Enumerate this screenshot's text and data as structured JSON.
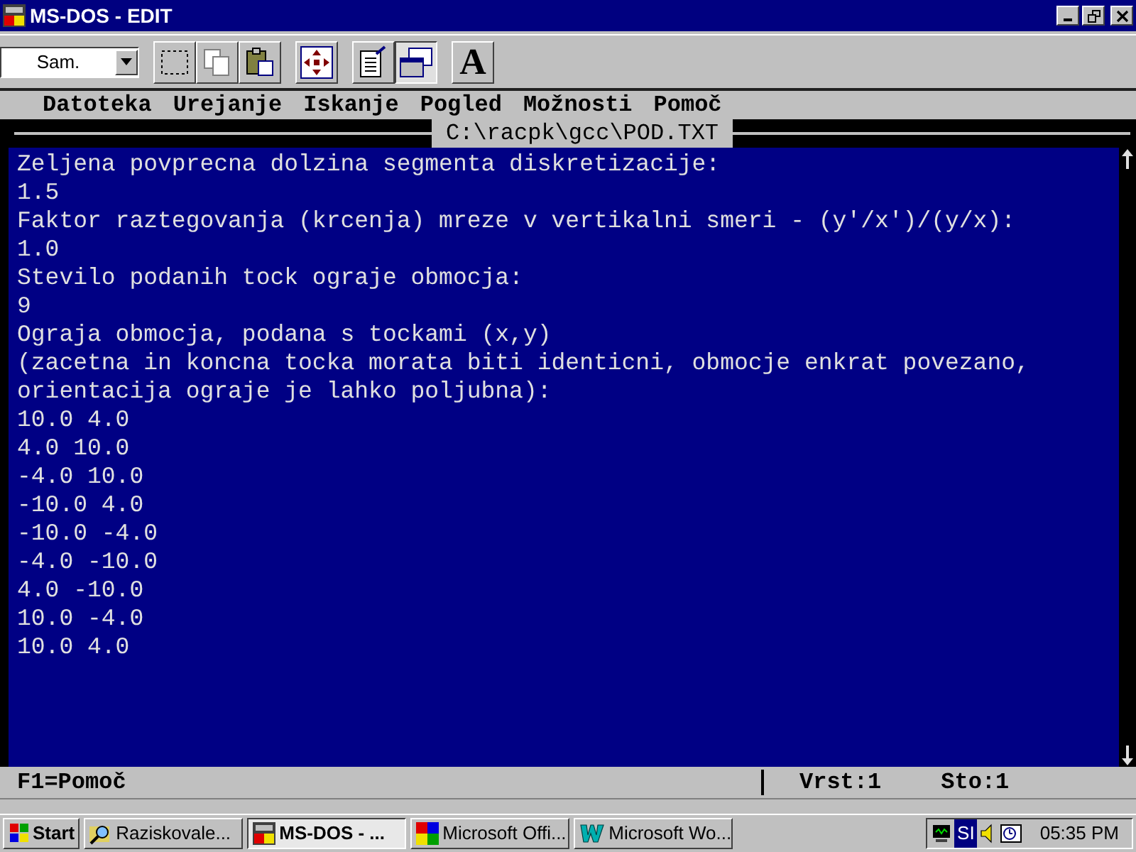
{
  "window": {
    "title": "MS-DOS - EDIT"
  },
  "toolbar": {
    "font_size": "Sam.",
    "buttons": [
      {
        "kind": "mark",
        "pressed": false
      },
      {
        "kind": "copy",
        "pressed": false
      },
      {
        "kind": "paste",
        "pressed": false
      },
      {
        "kind": "fullscreen",
        "pressed": false
      },
      {
        "kind": "properties",
        "pressed": false
      },
      {
        "kind": "background",
        "pressed": true
      },
      {
        "kind": "font",
        "label": "A",
        "pressed": false
      }
    ]
  },
  "menu": [
    "Datoteka",
    "Urejanje",
    "Iskanje",
    "Pogled",
    "Možnosti",
    "Pomoč"
  ],
  "editor": {
    "file_name": "C:\\racpk\\gcc\\POD.TXT",
    "lines": [
      "Zeljena povprecna dolzina segmenta diskretizacije:",
      "1.5",
      "Faktor raztegovanja (krcenja) mreze v vertikalni smeri - (y'/x')/(y/x):",
      "1.0",
      "Stevilo podanih tock ograje obmocja:",
      "9",
      "Ograja obmocja, podana s tockami (x,y)",
      "(zacetna in koncna tocka morata biti identicni, obmocje enkrat povezano,",
      "orientacija ograje je lahko poljubna):",
      "10.0 4.0",
      "4.0 10.0",
      "-4.0 10.0",
      "-10.0 4.0",
      "-10.0 -4.0",
      "-4.0 -10.0",
      "4.0 -10.0",
      "10.0 -4.0",
      "10.0 4.0"
    ]
  },
  "status_bar": {
    "hint": "F1=Pomoč",
    "row": "Vrst:1",
    "column": "Sto:1"
  },
  "taskbar": {
    "start": "Start",
    "tasks": [
      {
        "kind": "explorer",
        "label": "Raziskovale...",
        "selected": false
      },
      {
        "kind": "dos",
        "label": "MS-DOS - ...",
        "selected": true
      },
      {
        "kind": "office",
        "label": "Microsoft Offi...",
        "selected": false
      },
      {
        "kind": "word",
        "label": "Microsoft Wo...",
        "selected": false
      }
    ],
    "language": "SI",
    "time": "05:35 PM"
  }
}
